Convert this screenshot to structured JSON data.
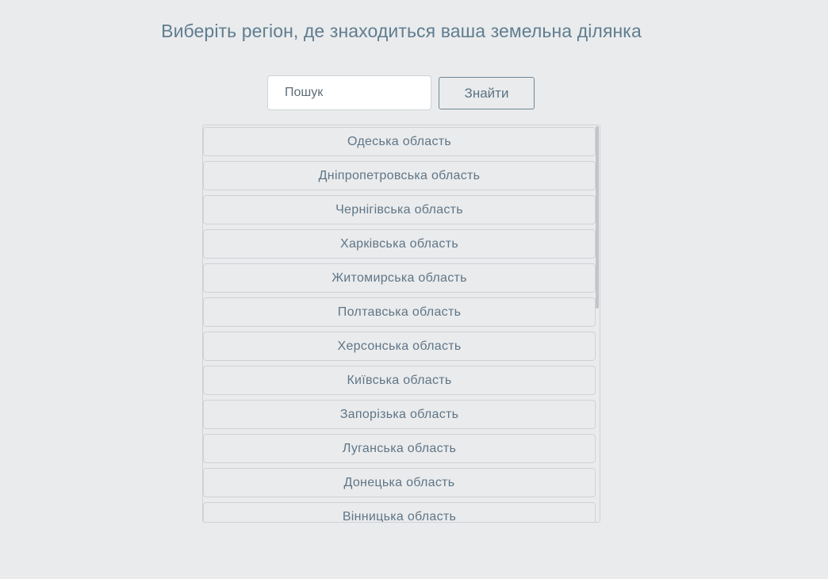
{
  "header": {
    "title": "Виберіть регіон, де знаходиться ваша земельна ділянка"
  },
  "search": {
    "placeholder": "Пошук",
    "value": "",
    "button_label": "Знайти"
  },
  "regions": [
    {
      "label": "Одеська область"
    },
    {
      "label": "Дніпропетровська область"
    },
    {
      "label": "Чернігівська область"
    },
    {
      "label": "Харківська область"
    },
    {
      "label": "Житомирська область"
    },
    {
      "label": "Полтавська область"
    },
    {
      "label": "Херсонська область"
    },
    {
      "label": "Київська область"
    },
    {
      "label": "Запорізька область"
    },
    {
      "label": "Луганська область"
    },
    {
      "label": "Донецька область"
    },
    {
      "label": "Вінницька область"
    }
  ],
  "colors": {
    "background": "#eaebed",
    "accent_text": "#5f7d8f",
    "border": "#cfd2d5",
    "button_border": "#6f8796"
  }
}
